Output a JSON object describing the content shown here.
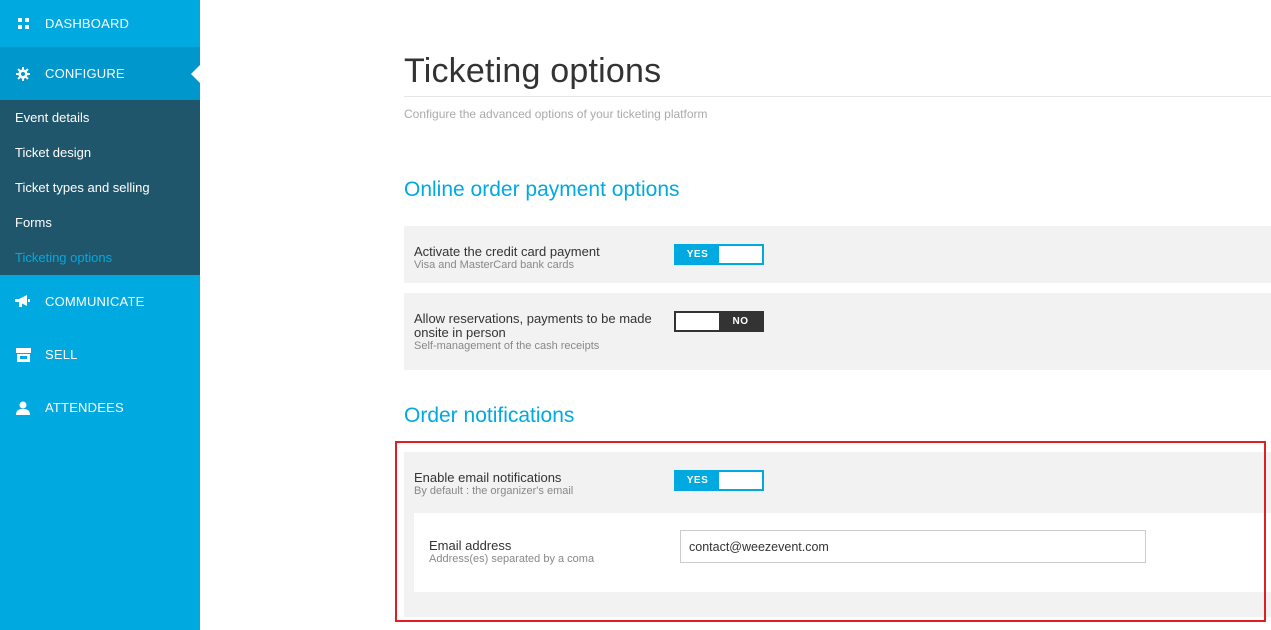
{
  "sidebar": {
    "main_items": [
      {
        "label": "DASHBOARD",
        "icon": "grid-icon"
      },
      {
        "label": "CONFIGURE",
        "icon": "gear-icon"
      },
      {
        "label": "COMMUNICATE",
        "icon": "megaphone-icon"
      },
      {
        "label": "SELL",
        "icon": "store-icon"
      },
      {
        "label": "ATTENDEES",
        "icon": "person-icon"
      }
    ],
    "sub_items": [
      {
        "label": "Event details"
      },
      {
        "label": "Ticket design"
      },
      {
        "label": "Ticket types and selling"
      },
      {
        "label": "Forms"
      },
      {
        "label": "Ticketing options"
      }
    ]
  },
  "page": {
    "title": "Ticketing options",
    "subtitle": "Configure the advanced options of your ticketing platform"
  },
  "payment": {
    "section_title": "Online order payment options",
    "credit_card": {
      "label": "Activate the credit card payment",
      "hint": "Visa and MasterCard bank cards",
      "toggle_label": "YES",
      "state": "on"
    },
    "reservations": {
      "label_line1": "Allow reservations, payments to be made",
      "label_line2": "onsite in person",
      "hint": "Self-management of the cash receipts",
      "toggle_label": "NO",
      "state": "off"
    }
  },
  "notifications": {
    "section_title": "Order notifications",
    "email_notifications": {
      "label": "Enable email notifications",
      "hint": "By default : the organizer's email",
      "toggle_label": "YES",
      "state": "on"
    },
    "email_address": {
      "label": "Email address",
      "hint": "Address(es) separated by a coma",
      "value": "contact@weezevent.com"
    }
  },
  "colors": {
    "accent": "#00a9e0",
    "submenu_bg": "#20566b",
    "highlight": "#e02020"
  }
}
